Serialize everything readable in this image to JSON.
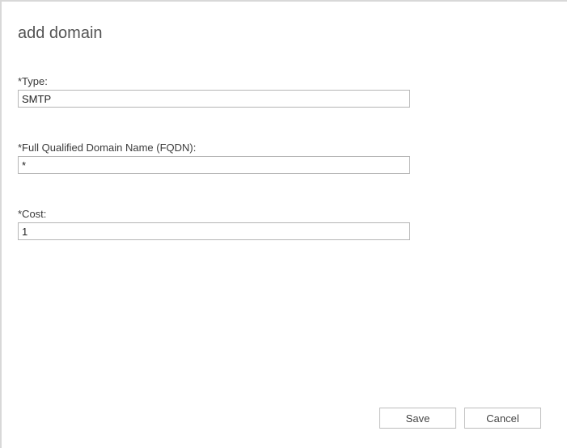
{
  "dialog": {
    "title": "add domain"
  },
  "form": {
    "type": {
      "label": "*Type:",
      "value": "SMTP"
    },
    "fqdn": {
      "label": "*Full Qualified Domain Name (FQDN):",
      "value": "*"
    },
    "cost": {
      "label": "*Cost:",
      "value": "1"
    }
  },
  "buttons": {
    "save": "Save",
    "cancel": "Cancel"
  }
}
